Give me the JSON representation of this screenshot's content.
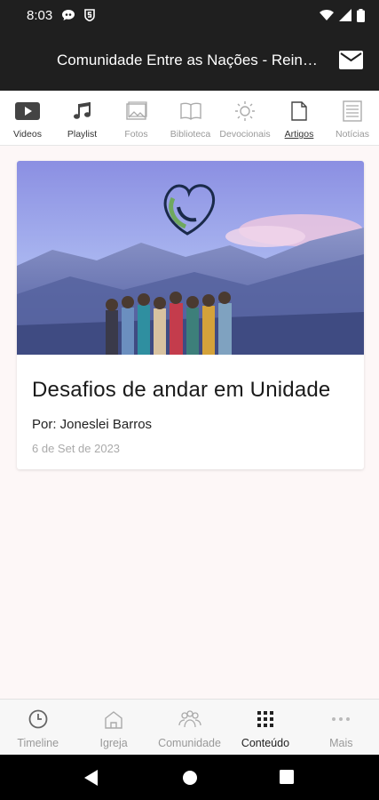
{
  "status_bar": {
    "time": "8:03",
    "icons": [
      "chat-bubble-icon",
      "s-shield-icon",
      "wifi-icon",
      "signal-icon",
      "battery-icon"
    ]
  },
  "app_bar": {
    "title": "Comunidade Entre as Nações - Reino...",
    "action_icon": "mail-icon"
  },
  "category_tabs": [
    {
      "label": "Videos",
      "icon": "video-icon"
    },
    {
      "label": "Playlist",
      "icon": "music-note-icon"
    },
    {
      "label": "Fotos",
      "icon": "photo-icon"
    },
    {
      "label": "Biblioteca",
      "icon": "book-icon"
    },
    {
      "label": "Devocionais",
      "icon": "sun-icon"
    },
    {
      "label": "Artigos",
      "icon": "document-icon",
      "active": true
    },
    {
      "label": "Notícias",
      "icon": "newspaper-icon"
    }
  ],
  "article": {
    "title": "Desafios de andar em Unidade",
    "author": "Por: Joneslei Barros",
    "date": "6 de Set de 2023"
  },
  "bottom_nav": [
    {
      "label": "Timeline",
      "icon": "clock-icon"
    },
    {
      "label": "Igreja",
      "icon": "church-icon"
    },
    {
      "label": "Comunidade",
      "icon": "community-icon"
    },
    {
      "label": "Conteúdo",
      "icon": "grid-icon",
      "active": true
    },
    {
      "label": "Mais",
      "icon": "more-dots-icon"
    }
  ],
  "colors": {
    "app_bar": "#1f1f1f",
    "background": "#fdf7f7",
    "inactive": "#999999",
    "active": "#222222"
  }
}
